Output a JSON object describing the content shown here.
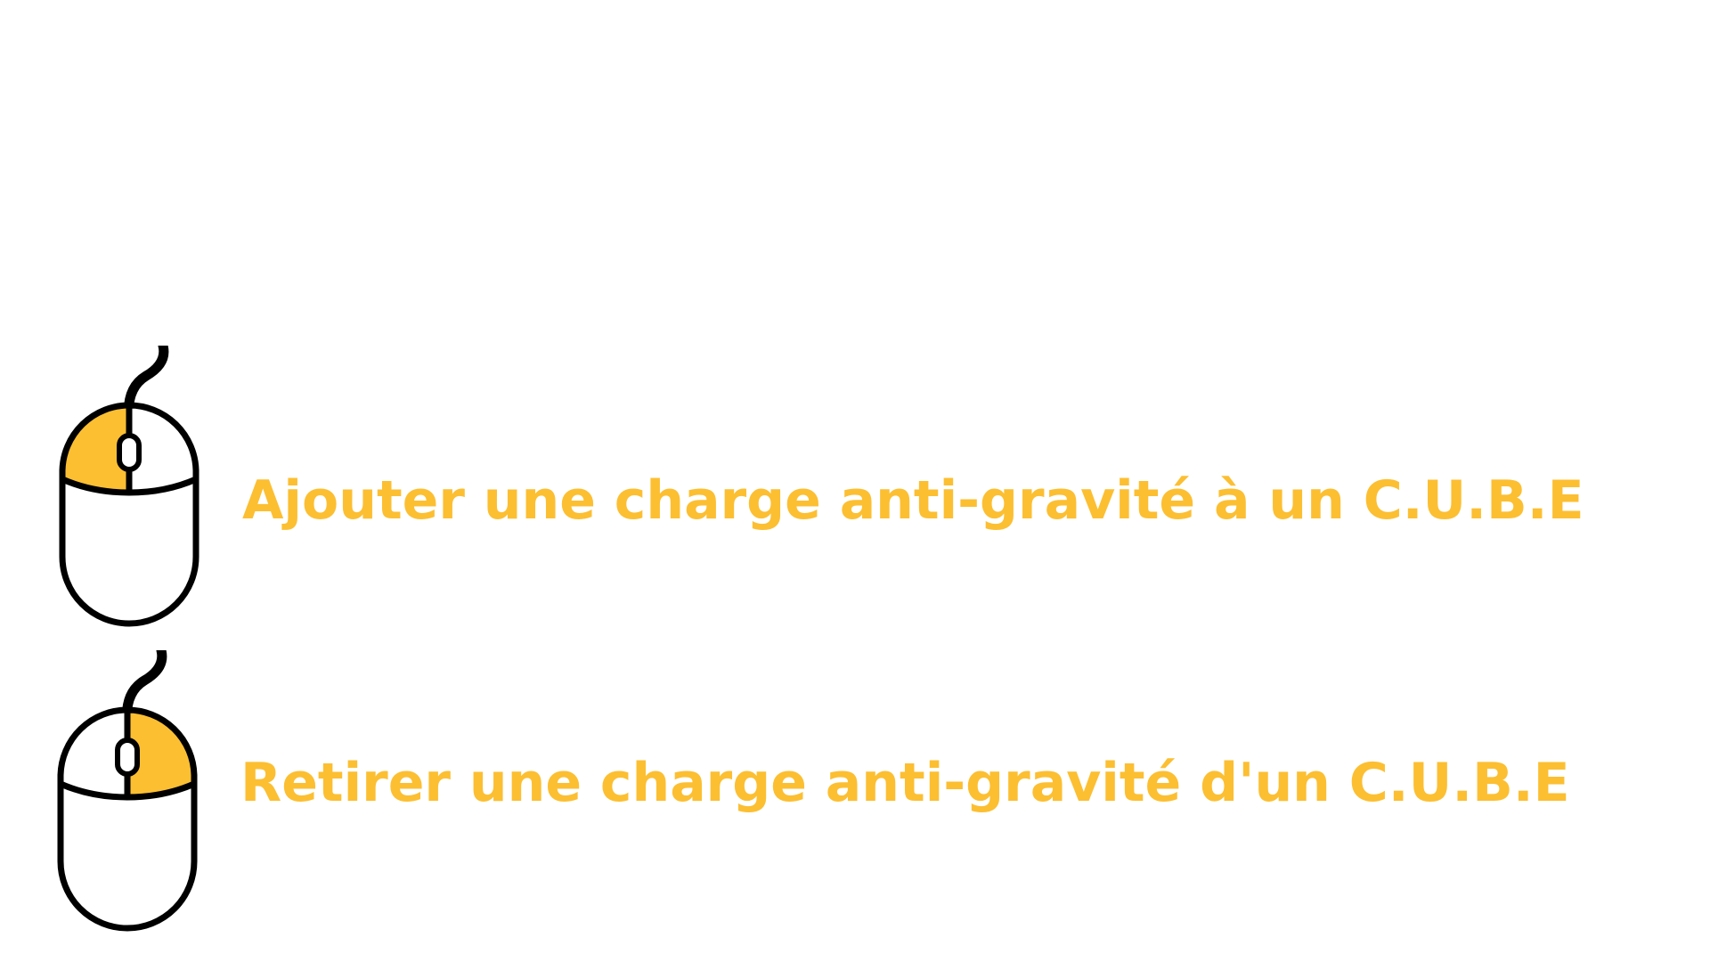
{
  "colors": {
    "accent": "#fcbf32",
    "outline": "#000000",
    "background": "#ffffff"
  },
  "controls": [
    {
      "icon": "mouse-left-click-icon",
      "highlighted_button": "left",
      "label": "Ajouter une charge anti-gravité à un C.U.B.E"
    },
    {
      "icon": "mouse-right-click-icon",
      "highlighted_button": "right",
      "label": "Retirer une charge anti-gravité d'un C.U.B.E"
    }
  ]
}
